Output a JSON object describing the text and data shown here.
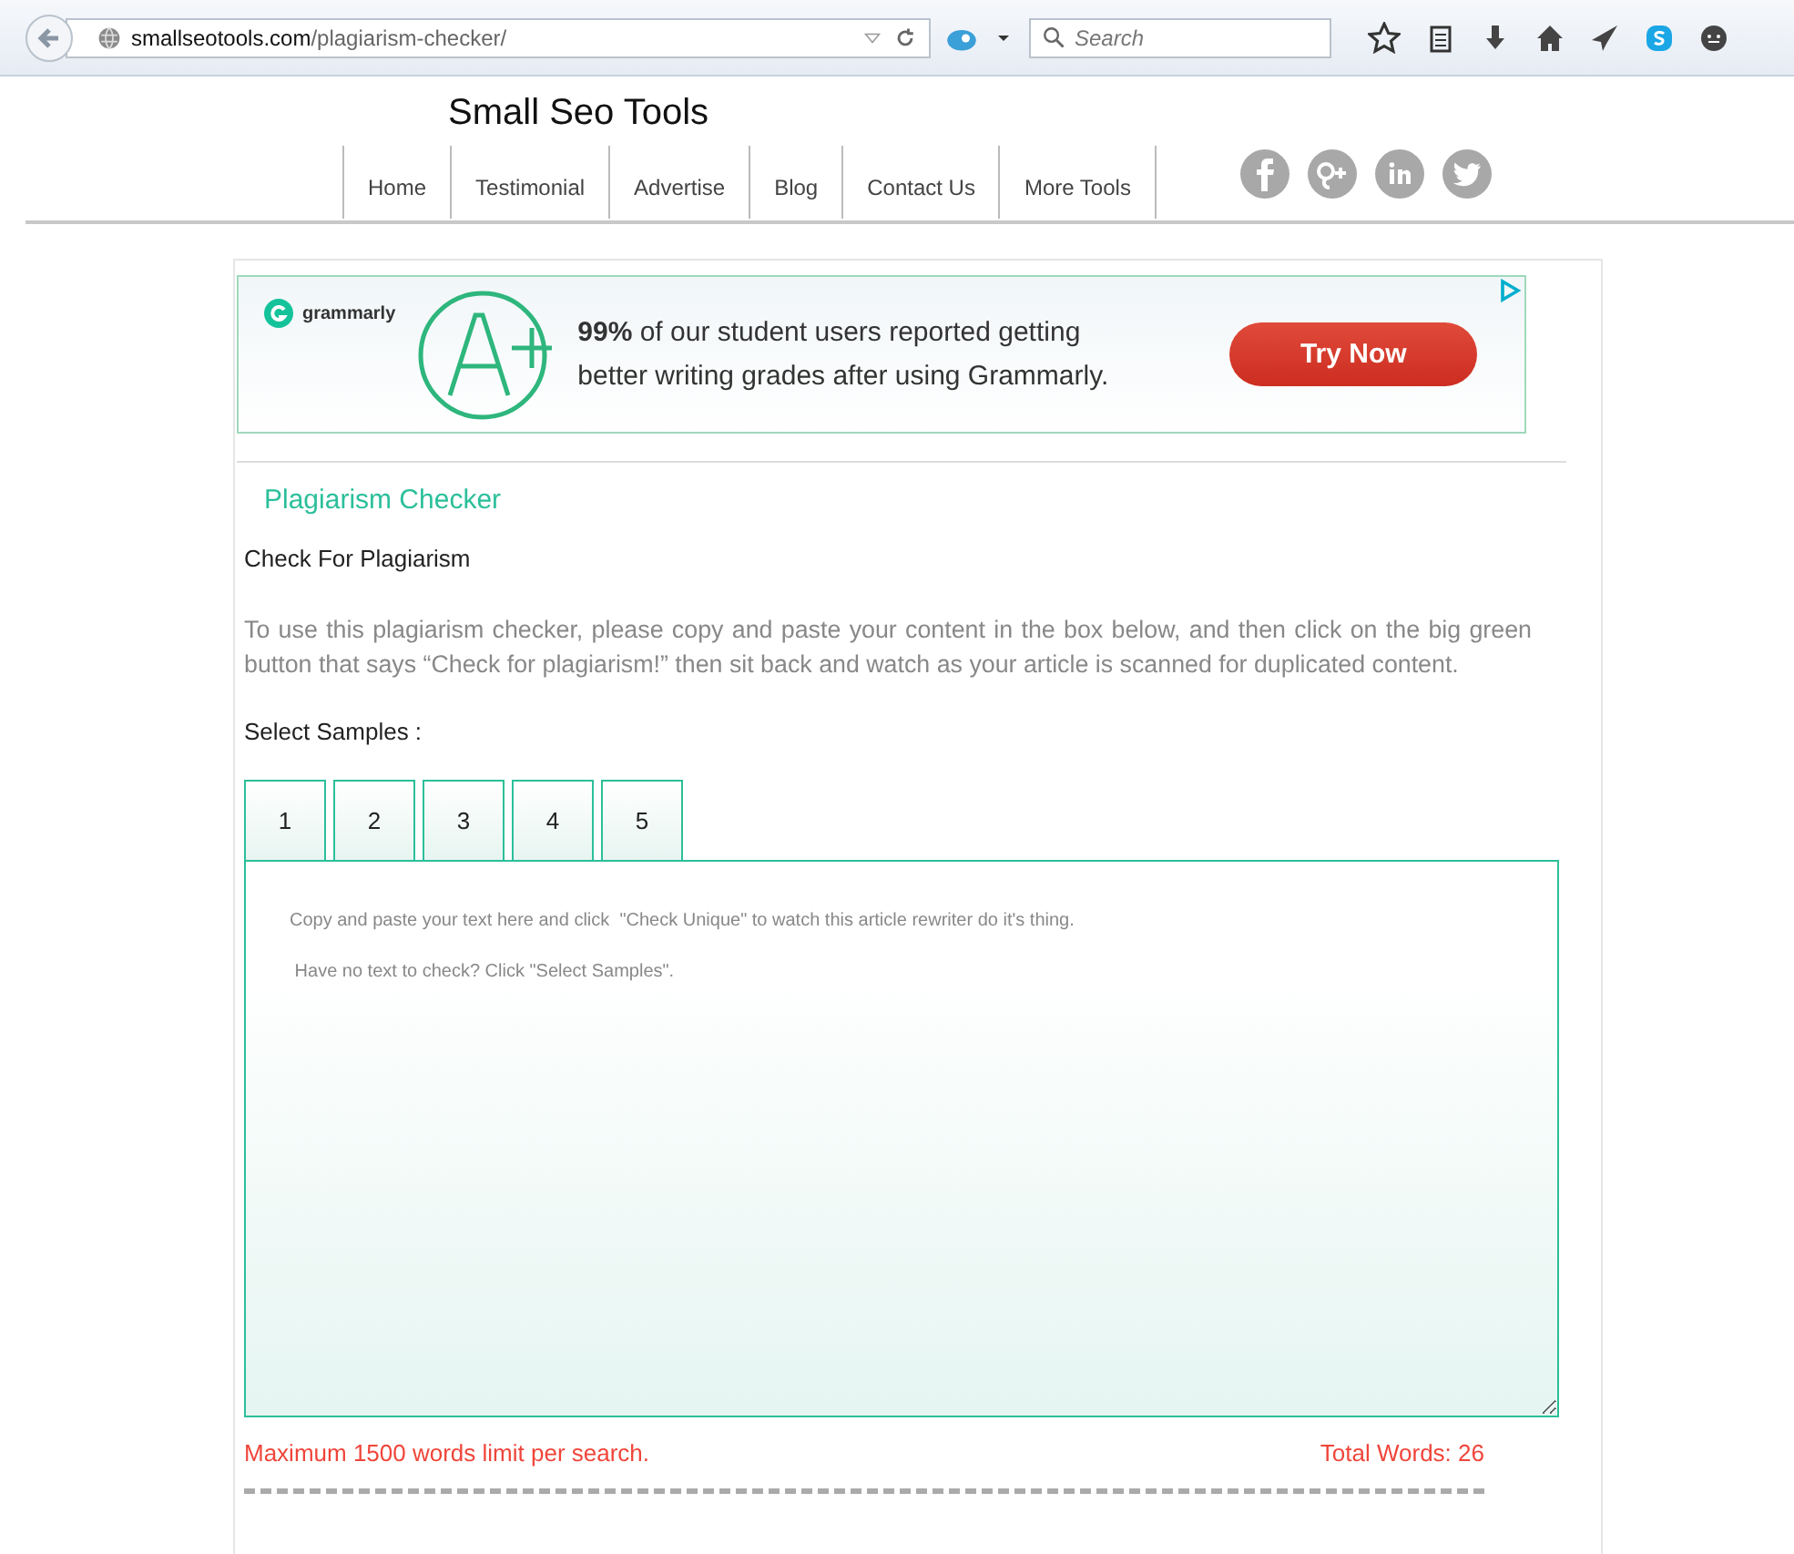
{
  "browser": {
    "url_domain": "smallseotools.com",
    "url_path": "/plagiarism-checker/",
    "search_placeholder": "Search"
  },
  "site": {
    "title": "Small Seo Tools"
  },
  "nav": [
    {
      "label": "Home"
    },
    {
      "label": "Testimonial"
    },
    {
      "label": "Advertise"
    },
    {
      "label": "Blog"
    },
    {
      "label": "Contact Us"
    },
    {
      "label": "More Tools"
    }
  ],
  "ad": {
    "brand": "grammarly",
    "headline": "**99%** of our student users reported getting better writing grades after using Grammarly.",
    "button": "Try Now"
  },
  "heading": "Plagiarism Checker",
  "subheading": "Check For Plagiarism",
  "intro": "To use this plagiarism checker, please copy and paste your content in the box below, and then click on the big green button that says “Check for plagiarism!” then sit back and watch as your article is scanned for duplicated content.",
  "samples_label": "Select Samples :",
  "sample_tabs": [
    {
      "label": "1",
      "selected": false
    },
    {
      "label": "2",
      "selected": false
    },
    {
      "label": "3",
      "selected": false
    },
    {
      "label": "4",
      "selected": false
    },
    {
      "label": "5",
      "selected": false
    }
  ],
  "editor": {
    "placeholder": "Copy and paste your text here and click  \"Check Unique\" to watch this article rewriter do it's thing.\n\n Have no text to check? Click \"Select Samples\"."
  },
  "limit_note": "Maximum 1500 words limit per search.",
  "word_count": "Total Words: 26"
}
